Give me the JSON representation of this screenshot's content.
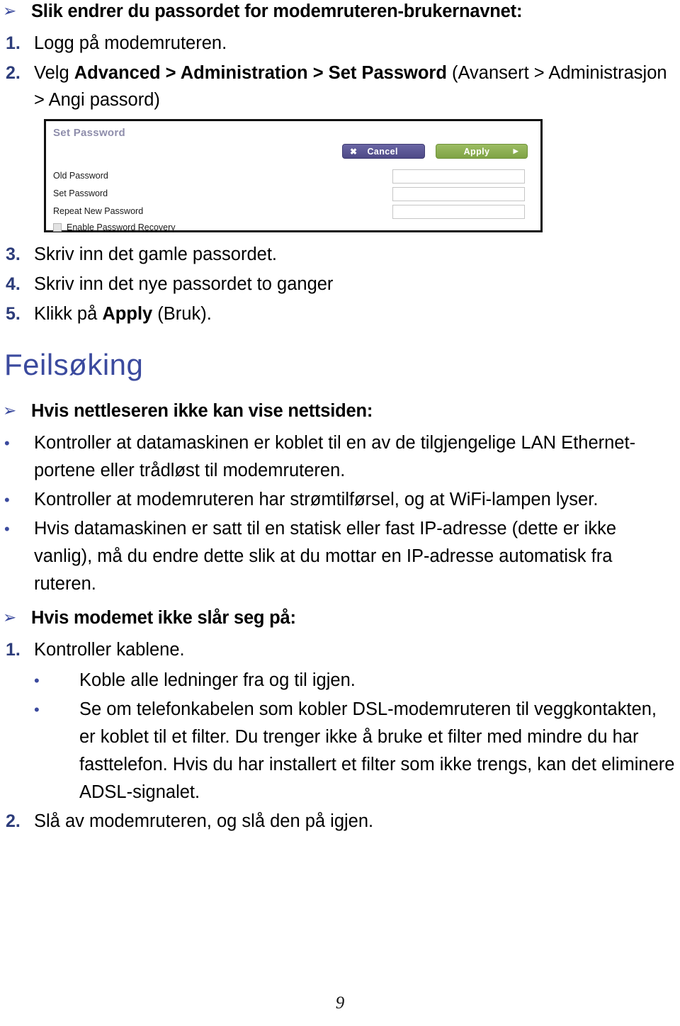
{
  "page": {
    "number": "9",
    "language": "no"
  },
  "icons": {
    "arrow_bullet": "➢",
    "round_bullet": "•",
    "cancel_x": "✖",
    "apply_triangle": "▶"
  },
  "colors": {
    "heading_blue": "#3b4a9e",
    "list_number_blue": "#2c3c7a",
    "bullet_blue": "#3b4a9e",
    "panel_title_gray": "#8e8dab",
    "cancel_purple": "#575394",
    "apply_green": "#8aad4e",
    "panel_border": "#111111",
    "text_black": "#000000"
  },
  "section_password": {
    "heading": "Slik endrer du passordet for modemruteren-brukernavnet:",
    "steps_before": [
      {
        "number": "1.",
        "text": "Logg på modemruteren."
      },
      {
        "number": "2.",
        "text_parts": [
          {
            "text": "Velg ",
            "bold": false
          },
          {
            "text": "Advanced > Administration > Set Password",
            "bold": true
          },
          {
            "text": " (Avansert > Administrasjon > Angi passord)",
            "bold": false
          }
        ]
      }
    ],
    "steps_after": [
      {
        "number": "3.",
        "text": "Skriv inn det gamle passordet."
      },
      {
        "number": "4.",
        "text": "Skriv inn det nye passordet to ganger"
      },
      {
        "number": "5.",
        "text_parts": [
          {
            "text": "Klikk på ",
            "bold": false
          },
          {
            "text": "Apply",
            "bold": true
          },
          {
            "text": " (Bruk).",
            "bold": false
          }
        ]
      }
    ]
  },
  "screenshot_panel": {
    "title": "Set Password",
    "buttons": {
      "cancel": "Cancel",
      "apply": "Apply"
    },
    "fields": [
      {
        "label": "Old Password",
        "value": ""
      },
      {
        "label": "Set Password",
        "value": ""
      },
      {
        "label": "Repeat New Password",
        "value": ""
      }
    ],
    "checkbox": {
      "label": "Enable Password Recovery",
      "checked": false
    }
  },
  "section_troubleshooting": {
    "heading": "Feilsøking",
    "group_browser": {
      "heading": "Hvis nettleseren ikke kan vise nettsiden:",
      "bullets": [
        "Kontroller at datamaskinen er koblet til en av de tilgjengelige LAN Ethernet-portene eller trådløst til modemruteren.",
        "Kontroller at modemruteren har strømtilførsel, og at WiFi-lampen lyser.",
        "Hvis datamaskinen er satt til en statisk eller fast IP-adresse (dette er ikke vanlig), må du endre dette slik at du mottar en IP-adresse automatisk fra ruteren."
      ]
    },
    "group_modem": {
      "heading": "Hvis modemet ikke slår seg på:",
      "items": [
        {
          "number": "1.",
          "text": "Kontroller kablene.",
          "sub_bullets": [
            "Koble alle ledninger fra og til igjen.",
            "Se om telefonkabelen som kobler DSL-modemruteren til veggkontakten, er koblet til et filter. Du trenger ikke å bruke et filter med mindre du har fasttelefon. Hvis du har installert et filter som ikke trengs, kan det eliminere ADSL-signalet."
          ]
        },
        {
          "number": "2.",
          "text": "Slå av modemruteren, og slå den på igjen.",
          "sub_bullets": []
        }
      ]
    }
  }
}
